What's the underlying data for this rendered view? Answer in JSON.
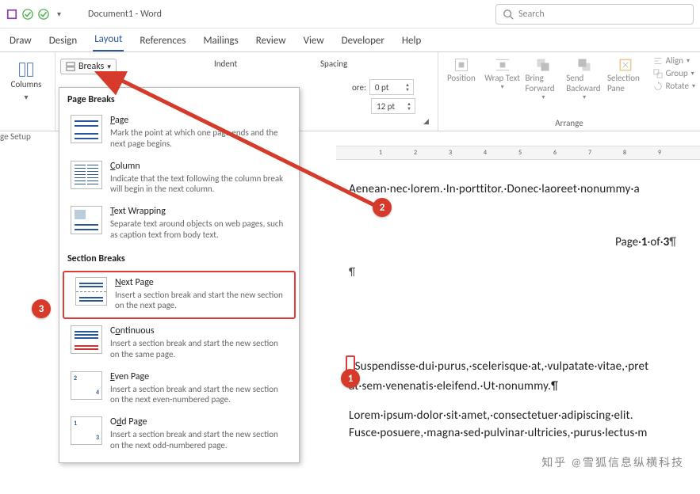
{
  "titlebar": {
    "doc": "Document1  -  Word",
    "search_placeholder": "Search"
  },
  "tabs": [
    "Draw",
    "Design",
    "Layout",
    "References",
    "Mailings",
    "Review",
    "View",
    "Developer",
    "Help"
  ],
  "active_tab": "Layout",
  "ribbon": {
    "columns_label": "Columns",
    "breaks_label": "Breaks",
    "page_setup_label": "ge Setup",
    "indent_label": "Indent",
    "spacing_label": "Spacing",
    "before_label": "ore:",
    "spin_before": "0 pt",
    "spin_after": "12 pt",
    "arrange_label": "Arrange",
    "arr": {
      "position": "Position",
      "wrap": "Wrap Text",
      "bring": "Bring Forward",
      "send": "Send Backward",
      "selpane": "Selection Pane",
      "align": "Align",
      "group": "Group",
      "rotate": "Rotate"
    }
  },
  "breaks_menu": {
    "sect1": "Page Breaks",
    "sect2": "Section Breaks",
    "items": [
      {
        "title_pre": "",
        "title_u": "P",
        "title_post": "age",
        "desc": "Mark the point at which one page ends and the next page begins."
      },
      {
        "title_pre": "",
        "title_u": "C",
        "title_post": "olumn",
        "desc": "Indicate that the text following the column break will begin in the next column."
      },
      {
        "title_pre": "",
        "title_u": "T",
        "title_post": "ext Wrapping",
        "desc": "Separate text around objects on web pages, such as caption text from body text."
      },
      {
        "title_pre": "",
        "title_u": "N",
        "title_post": "ext Page",
        "desc": "Insert a section break and start the new section on the next page."
      },
      {
        "title_pre": "C",
        "title_u": "o",
        "title_post": "ntinuous",
        "desc": "Insert a section break and start the new section on the same page."
      },
      {
        "title_pre": "",
        "title_u": "E",
        "title_post": "ven Page",
        "desc": "Insert a section break and start the new section on the next even-numbered page."
      },
      {
        "title_pre": "O",
        "title_u": "d",
        "title_post": "d Page",
        "desc": "Insert a section break and start the new section on the next odd-numbered page."
      }
    ]
  },
  "doc": {
    "line1": "Aenean·nec·lorem.·In·porttitor.·Donec·laoreet·nonummy·a",
    "footer_pre": "Page·",
    "footer_p1": "1",
    "footer_mid": "·of·",
    "footer_p2": "3",
    "footer_pil": "¶",
    "pilcrow": "¶",
    "line2a": "Suspendisse·dui·purus,·scelerisque·at,·vulpatate·vitae,·pret",
    "line2b": "at·sem·venenatis·eleifend.·Ut·nonummy.¶",
    "line3a": "Lorem·ipsum·dolor·sit·amet,·consectetuer·adipiscing·elit.",
    "line3b": "Fusce·posuere,·magna·sed·pulvinar·ultricies,·purus·lectus·m"
  },
  "callouts": {
    "c1": "1",
    "c2": "2",
    "c3": "3"
  },
  "watermark": "知乎 @雪狐信息纵横科技"
}
